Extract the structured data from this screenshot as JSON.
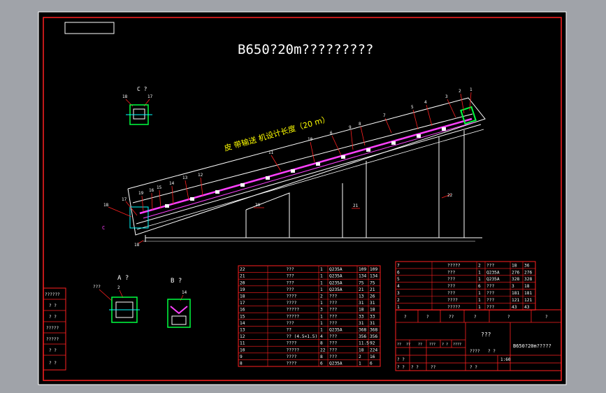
{
  "drawing": {
    "title": "B650?20m?????????",
    "length_note": "皮 带输送 机设计长度（20 m）",
    "views": {
      "c": "C ?",
      "a": "A ?",
      "b": "B ?"
    }
  },
  "callouts": {
    "main": [
      "1",
      "2",
      "3",
      "4",
      "5",
      "6",
      "7",
      "8",
      "9",
      "10",
      "11",
      "12",
      "13",
      "14",
      "15",
      "16",
      "17",
      "18",
      "19",
      "20",
      "21",
      "22"
    ],
    "c_view": [
      "18",
      "17"
    ],
    "a_view": [
      "???",
      "2"
    ],
    "b_view": [
      "14"
    ],
    "left_symbol": "C"
  },
  "left_strip": [
    "??????",
    "?  ?",
    "?  ?",
    "?????",
    "?????",
    "?  ?",
    "?  ?"
  ],
  "parts_left": [
    [
      "22",
      "???",
      "1",
      "Q235A",
      "109",
      "109"
    ],
    [
      "21",
      "???",
      "1",
      "Q235A",
      "134",
      "134"
    ],
    [
      "20",
      "???",
      "1",
      "Q235A",
      "75",
      "75"
    ],
    [
      "19",
      "???",
      "1",
      "Q235A",
      "21",
      "21"
    ],
    [
      "18",
      "????",
      "2",
      "???",
      "13",
      "26"
    ],
    [
      "17",
      "????",
      "1",
      "???",
      "31",
      "31"
    ],
    [
      "16",
      "?????",
      "3",
      "???",
      "18",
      "18"
    ],
    [
      "15",
      "?????",
      "1",
      "???",
      "33",
      "33"
    ],
    [
      "14",
      "???",
      "1",
      "???",
      "31",
      "31"
    ],
    [
      "13",
      "??",
      "1",
      "Q235A",
      "368",
      "368"
    ],
    [
      "12",
      "?? (4.5×1.5)",
      "4",
      "???",
      "356",
      "356"
    ],
    [
      "11",
      "????",
      "8",
      "???",
      "11.5",
      "92"
    ],
    [
      "10",
      "?????",
      "22",
      "???",
      "18",
      "224"
    ],
    [
      "9",
      "????",
      "8",
      "???",
      "2",
      "16"
    ],
    [
      "8",
      "????",
      "6",
      "Q235A",
      "1",
      "6"
    ]
  ],
  "parts_right": [
    [
      "7",
      "?????",
      "2",
      "???",
      "18",
      "36"
    ],
    [
      "6",
      "???",
      "1",
      "Q235A",
      "276",
      "276"
    ],
    [
      "5",
      "???",
      "1",
      "Q235A",
      "328",
      "328"
    ],
    [
      "4",
      "???",
      "6",
      "???",
      "3",
      "18"
    ],
    [
      "3",
      "???",
      "1",
      "???",
      "181",
      "181"
    ],
    [
      "2",
      "????",
      "1",
      "???",
      "121",
      "121"
    ],
    [
      "1",
      "?????",
      "1",
      "???",
      "43",
      "43"
    ]
  ],
  "parts_header": [
    "?",
    "?",
    "??",
    "?",
    "?",
    "?"
  ],
  "title_block": {
    "center_label": "???",
    "drawing_name": "B650?20m?????",
    "scale": "1:60",
    "rev_labels": [
      "??",
      "??",
      "??",
      "???",
      "?  ?",
      "????"
    ],
    "bottom_labels": [
      "?  ?",
      "?  ?",
      "?  ?",
      "??"
    ],
    "small_labels": [
      "????",
      "?  ?",
      "?  ?"
    ]
  },
  "colors": {
    "background": "#000000",
    "frame": "#ffffff",
    "table_lines": "#ff2020",
    "callouts": "#ff2020",
    "belt": "#ff40ff",
    "title_text": "#ffffff",
    "note_text": "#ffff00",
    "parts_green": "#00ff40",
    "rollers_cyan": "#00ffff",
    "window_gray": "#a0a3a9"
  }
}
